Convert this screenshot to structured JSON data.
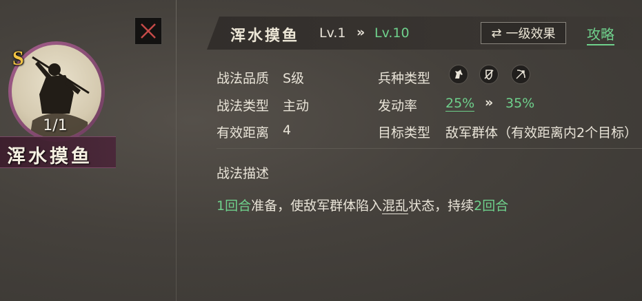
{
  "skill_card": {
    "grade_badge": "S",
    "uses": "1/1",
    "name": "浑水摸鱼"
  },
  "header": {
    "title": "浑水摸鱼",
    "level_current": "Lv.1",
    "level_arrow": "»",
    "level_max": "Lv.10",
    "effect_button_icon": "swap-icon",
    "effect_button_symbol": "⇄",
    "effect_button_label": "一级效果",
    "strategy_link": "攻略"
  },
  "details": {
    "quality_label": "战法品质",
    "quality_value": "S级",
    "type_label": "战法类型",
    "type_value": "主动",
    "range_label": "有效距离",
    "range_value": "4",
    "unit_label": "兵种类型",
    "unit_icons": [
      "cavalry-icon",
      "infantry-icon",
      "archer-icon"
    ],
    "rate_label": "发动率",
    "rate_current": "25%",
    "rate_arrow": "»",
    "rate_max": "35%",
    "target_label": "目标类型",
    "target_value": "敌军群体（有效距离内2个目标）"
  },
  "description": {
    "heading": "战法描述",
    "prep_turns": "1回合",
    "text_1": "准备，使敌军群体陷入",
    "status_keyword": "混乱",
    "text_2": "状态，持续",
    "duration": "2回合"
  },
  "colors": {
    "highlight_green": "#6fd18c",
    "badge_gold": "#f2c443",
    "portrait_ring": "#a45e8c"
  }
}
